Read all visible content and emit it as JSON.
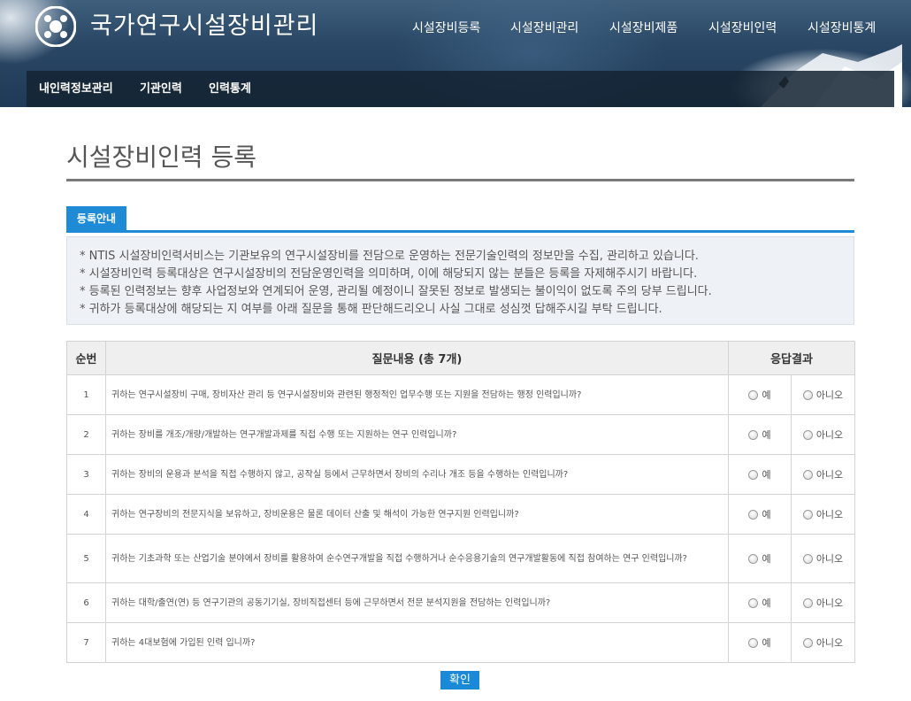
{
  "header": {
    "site_title": "국가연구시설장비관리",
    "main_nav": [
      "시설장비등록",
      "시설장비관리",
      "시설장비제품",
      "시설장비인력",
      "시설장비통계"
    ],
    "sub_nav": [
      "내인력정보관리",
      "기관인력",
      "인력통계"
    ]
  },
  "page": {
    "title": "시설장비인력 등록"
  },
  "notice": {
    "tab_label": "등록안내",
    "lines": [
      "* NTIS 시설장비인력서비스는 기관보유의 연구시설장비를 전담으로 운영하는 전문기술인력의 정보만을 수집, 관리하고 있습니다.",
      "* 시설장비인력 등록대상은 연구시설장비의 전담운영인력을 의미하며, 이에 해당되지 않는 분들은 등록을 자제해주시기 바랍니다.",
      "* 등록된 인력정보는 향후 사업정보와 연계되어 운영, 관리될 예정이니 잘못된 정보로 발생되는 불이익이 없도록 주의 당부 드립니다.",
      "* 귀하가 등록대상에 해당되는 지 여부를 아래 질문을 통해 판단해드리오니 사실 그대로 성심껏 답해주시길 부탁 드립니다."
    ]
  },
  "table": {
    "col_num": "순번",
    "col_question": "질문내용 (총 7개)",
    "col_answer": "응답결과",
    "yes_label": "예",
    "no_label": "아니오",
    "rows": [
      {
        "num": "1",
        "question": "귀하는 연구시설장비 구매, 장비자산 관리 등 연구시설장비와 관련된 행정적인 업무수행 또는 지원을 전담하는 행정 인력입니까?"
      },
      {
        "num": "2",
        "question": "귀하는 장비를 개조/개량/개발하는 연구개발과제를 직접 수행 또는 지원하는 연구 인력입니까?"
      },
      {
        "num": "3",
        "question": "귀하는 장비의 운용과 분석을 직접 수행하지 않고, 공작실 등에서 근무하면서 장비의 수리나 개조 등을 수행하는 인력입니까?"
      },
      {
        "num": "4",
        "question": "귀하는 연구장비의 전문지식을 보유하고, 장비운용은 물론 데이터 산출 및 해석이 가능한 연구지원 인력입니까?"
      },
      {
        "num": "5",
        "question": "귀하는 기초과학 또는 산업기술 분야에서 장비를 활용하여 순수연구개발을 직접 수행하거나 순수응용기술의 연구개발활동에 직접 참여하는 연구 인력입니까?"
      },
      {
        "num": "6",
        "question": "귀하는 대학/출연(연) 등 연구기관의 공동기기실, 장비직접센터 등에 근무하면서 전문 분석지원을 전담하는 인력입니까?"
      },
      {
        "num": "7",
        "question": "귀하는 4대보험에 가입된 인력 입니까?"
      }
    ]
  },
  "confirm_label": "확인",
  "colors": {
    "accent": "#1f8ad6",
    "header_bg": "#2a4866",
    "subnav_bg": "#14232f"
  }
}
